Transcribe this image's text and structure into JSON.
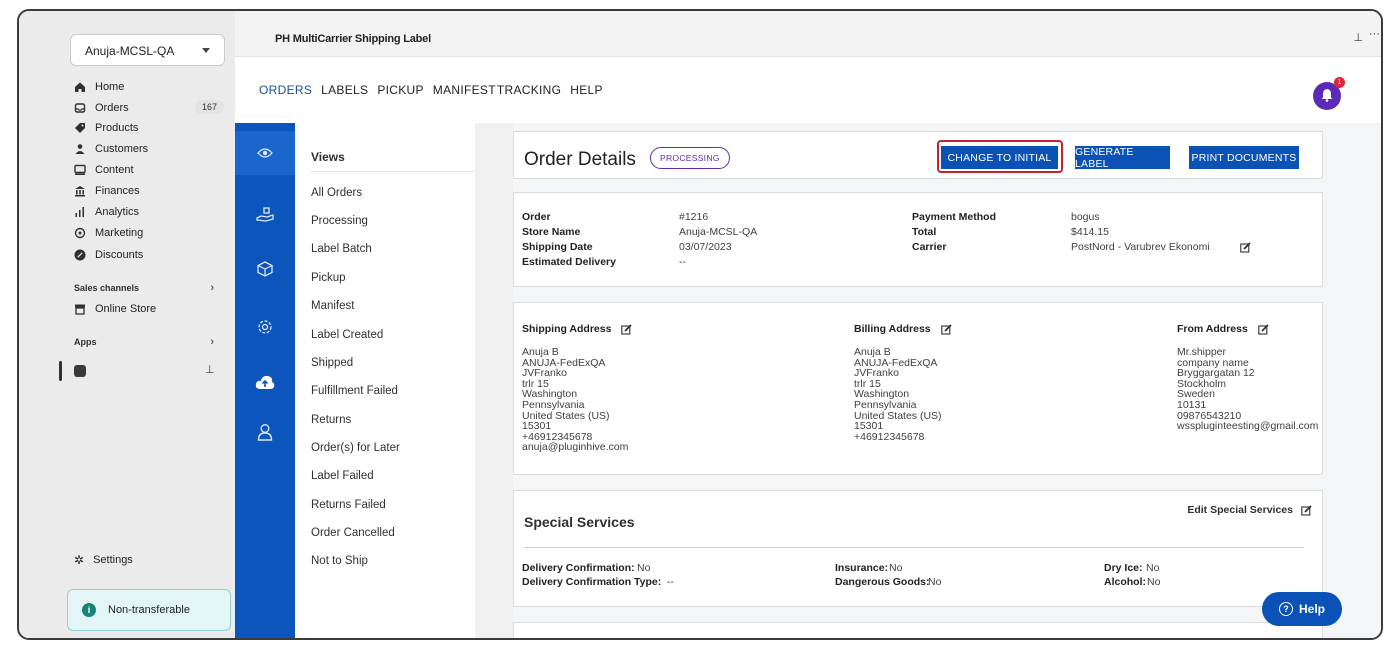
{
  "store": {
    "name": "Anuja-MCSL-QA"
  },
  "nav": {
    "items": [
      {
        "label": "Home",
        "icon": "home-icon"
      },
      {
        "label": "Orders",
        "icon": "orders-icon",
        "badge": "167"
      },
      {
        "label": "Products",
        "icon": "tag-icon"
      },
      {
        "label": "Customers",
        "icon": "person-icon"
      },
      {
        "label": "Content",
        "icon": "content-icon"
      },
      {
        "label": "Finances",
        "icon": "bank-icon"
      },
      {
        "label": "Analytics",
        "icon": "bar-chart-icon"
      },
      {
        "label": "Marketing",
        "icon": "target-icon"
      },
      {
        "label": "Discounts",
        "icon": "discount-icon"
      }
    ],
    "sales_channels": "Sales channels",
    "online_store": "Online Store",
    "apps": "Apps",
    "settings": "Settings",
    "non_transferable": "Non-transferable"
  },
  "app": {
    "title": "PH MultiCarrier Shipping Label",
    "menu": [
      "ORDERS",
      "LABELS",
      "PICKUP",
      "MANIFEST",
      "TRACKING",
      "HELP"
    ],
    "notification_count": "1"
  },
  "views": {
    "title": "Views",
    "items": [
      "All Orders",
      "Processing",
      "Label Batch",
      "Pickup",
      "Manifest",
      "Label Created",
      "Shipped",
      "Fulfillment Failed",
      "Returns",
      "Order(s) for Later",
      "Label Failed",
      "Returns Failed",
      "Order Cancelled",
      "Not to Ship"
    ]
  },
  "order": {
    "heading": "Order Details",
    "status": "PROCESSING",
    "buttons": {
      "change": "CHANGE TO INITIAL",
      "generate": "GENERATE LABEL",
      "print": "PRINT DOCUMENTS"
    },
    "fields_left": [
      {
        "label": "Order",
        "value": "#1216"
      },
      {
        "label": "Store Name",
        "value": "Anuja-MCSL-QA"
      },
      {
        "label": "Shipping Date",
        "value": "03/07/2023"
      },
      {
        "label": "Estimated Delivery",
        "value": "--"
      }
    ],
    "fields_right": [
      {
        "label": "Payment Method",
        "value": "bogus"
      },
      {
        "label": "Total",
        "value": "$414.15"
      },
      {
        "label": "Carrier",
        "value": "PostNord - Varubrev Ekonomi"
      }
    ]
  },
  "addresses": {
    "shipping": {
      "title": "Shipping Address",
      "lines": "Anuja B\nANUJA-FedExQA\nJVFranko\ntrlr 15\nWashington\nPennsylvania\nUnited States (US)\n15301\n+46912345678\nanuja@pluginhive.com"
    },
    "billing": {
      "title": "Billing Address",
      "lines": "Anuja B\nANUJA-FedExQA\nJVFranko\ntrlr 15\nWashington\nPennsylvania\nUnited States (US)\n15301\n+46912345678"
    },
    "from": {
      "title": "From Address",
      "lines": "Mr.shipper\ncompany name\nBryggargatan 12\nStockholm\nSweden\n10131\n09876543210\nwsspluginteesting@gmail.com"
    }
  },
  "special": {
    "title": "Special Services",
    "edit": "Edit Special Services",
    "delivery_confirmation_label": "Delivery Confirmation:",
    "delivery_confirmation_value": "No",
    "delivery_confirmation_type_label": "Delivery Confirmation Type:",
    "delivery_confirmation_type_value": "--",
    "insurance_label": "Insurance:",
    "insurance_value": "No",
    "dangerous_goods_label": "Dangerous Goods:",
    "dangerous_goods_value": "No",
    "dry_ice_label": "Dry Ice:",
    "dry_ice_value": "No",
    "alcohol_label": "Alcohol:",
    "alcohol_value": "No"
  },
  "help": {
    "label": "Help"
  }
}
